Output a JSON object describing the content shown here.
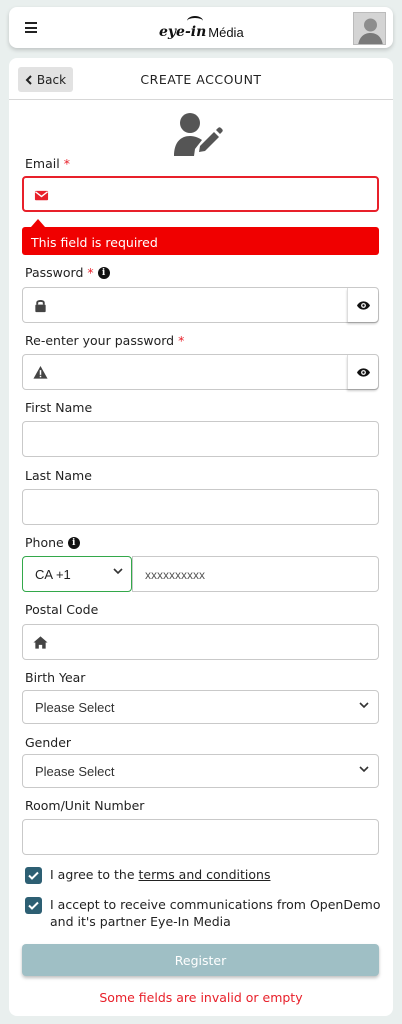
{
  "topbar": {
    "logo_main": "eye-in",
    "logo_sub": "Média"
  },
  "header": {
    "back_label": "Back",
    "title": "CREATE ACCOUNT"
  },
  "email": {
    "label": "Email",
    "required_mark": "*",
    "error": "This field is required"
  },
  "password": {
    "label": "Password",
    "required_mark": "*"
  },
  "reenter": {
    "label": "Re-enter your password",
    "required_mark": "*"
  },
  "first_name": {
    "label": "First Name"
  },
  "last_name": {
    "label": "Last Name"
  },
  "phone": {
    "label": "Phone",
    "country": "CA +1",
    "placeholder": "xxxxxxxxxx"
  },
  "postal": {
    "label": "Postal Code"
  },
  "birth_year": {
    "label": "Birth Year",
    "value": "Please Select"
  },
  "gender": {
    "label": "Gender",
    "value": "Please Select"
  },
  "room": {
    "label": "Room/Unit Number"
  },
  "agree_terms": {
    "prefix": "I agree to the",
    "link": "terms and conditions"
  },
  "communications": {
    "text_line1": "I accept to receive communications from OpenDemo",
    "text_line2": "and it's partner Eye-In Media"
  },
  "register_label": "Register",
  "form_error": "Some fields are invalid or empty",
  "colors": {
    "error": "#e8202a",
    "accent": "#2d5f73",
    "register_bg": "#9fbfc5"
  }
}
